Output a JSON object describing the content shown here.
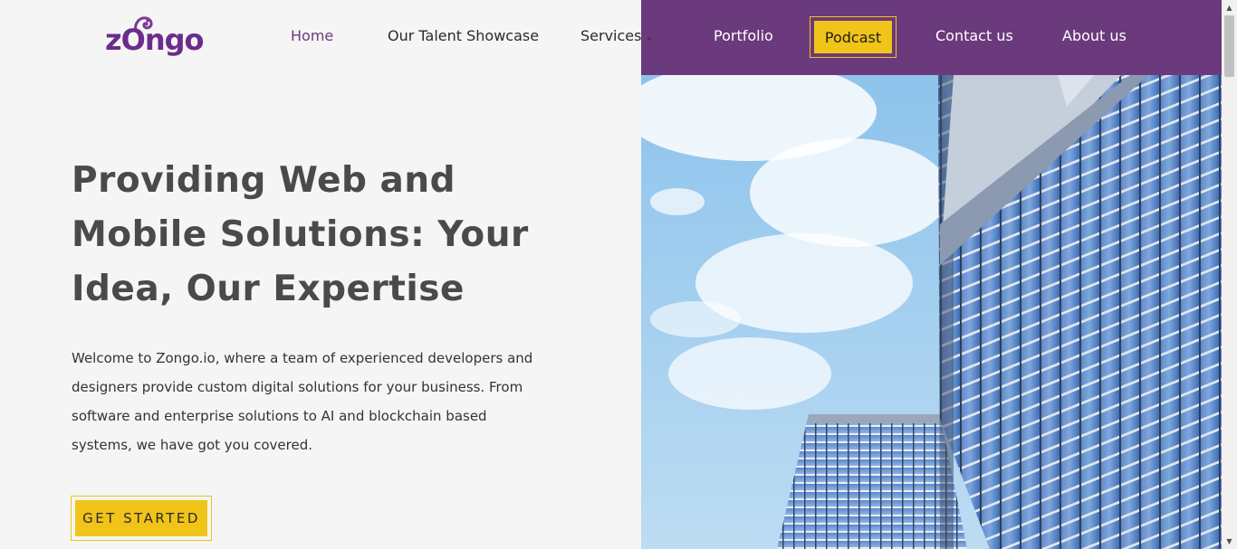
{
  "brand": {
    "logo_text": "zOngo",
    "logo_color": "#6b2c8a"
  },
  "nav": {
    "items": [
      {
        "label": "Home"
      },
      {
        "label": "Our Talent Showcase"
      },
      {
        "label": "Services"
      },
      {
        "label": "Portfolio"
      },
      {
        "label": "Podcast"
      },
      {
        "label": "Contact us"
      },
      {
        "label": "About us"
      }
    ],
    "services_icon": "chevron-down-icon"
  },
  "hero": {
    "title": "Providing Web and Mobile Solutions: Your Idea, Our Expertise",
    "body": "Welcome to Zongo.io, where a team of experienced developers and designers provide custom digital solutions for your business. From software and enterprise solutions to AI and blockchain based systems, we have got you covered.",
    "cta_label": "GET STARTED",
    "image_subject": "glass skyscrapers against blue sky with clouds"
  },
  "colors": {
    "accent_purple": "#6b3a7d",
    "accent_yellow": "#f0c419",
    "background": "#f5f5f5",
    "text_heading": "#4a4a4a"
  }
}
